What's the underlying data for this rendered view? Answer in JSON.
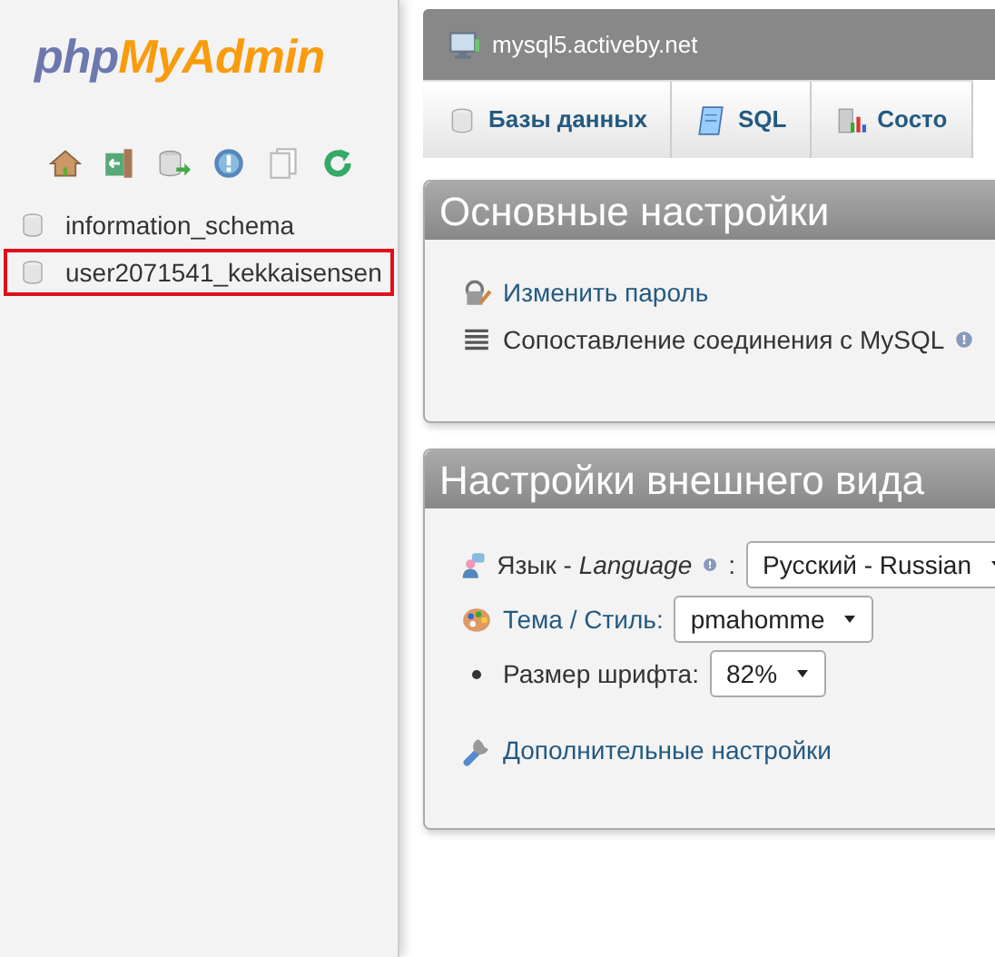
{
  "sidebar": {
    "logo": {
      "part_1": "php",
      "part_2": "MyAdmin"
    },
    "databases": [
      {
        "name": "information_schema",
        "highlighted": false
      },
      {
        "name": "user2071541_kekkaisensen",
        "highlighted": true
      }
    ]
  },
  "server_bar": {
    "title": "mysql5.activeby.net"
  },
  "tabs": [
    {
      "label": "Базы данных"
    },
    {
      "label": "SQL"
    },
    {
      "label": "Состо"
    }
  ],
  "panels": [
    {
      "title": "Основные настройки",
      "items": [
        {
          "kind": "link",
          "label": "Изменить пароль"
        },
        {
          "kind": "text",
          "label": "Сопоставление соединения с MySQL",
          "help": true
        }
      ]
    },
    {
      "title": "Настройки внешнего вида",
      "items": [
        {
          "kind": "select",
          "label_parts": [
            "Язык - ",
            "Language",
            " :"
          ],
          "value": "Русский - Russian",
          "help": true
        },
        {
          "kind": "select",
          "label": "Тема / Стиль:",
          "link": true,
          "value": "pmahomme"
        },
        {
          "kind": "select",
          "label": "Размер шрифта:",
          "value": "82%"
        },
        {
          "kind": "link",
          "label": "Дополнительные настройки"
        }
      ]
    }
  ]
}
